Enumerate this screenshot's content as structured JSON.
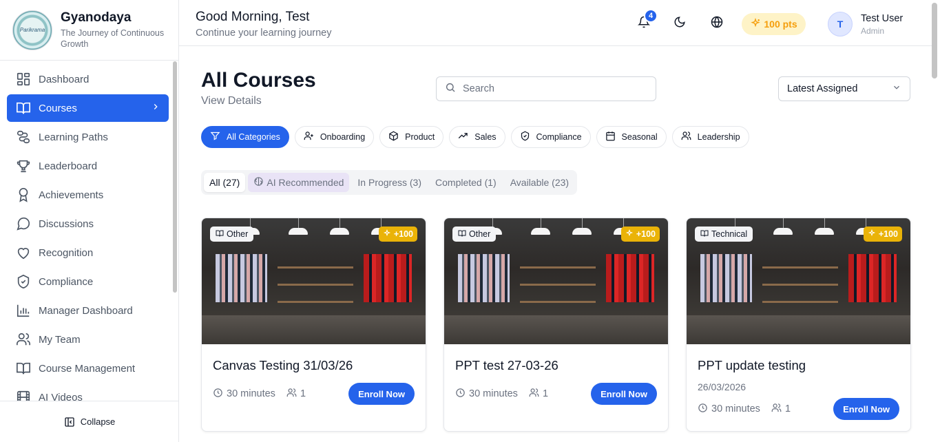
{
  "brand": {
    "title": "Gyanodaya",
    "subtitle": "The Journey of Continuous Growth",
    "logo_text": "Parikrama"
  },
  "sidebar": {
    "items": [
      {
        "label": "Dashboard",
        "icon": "dashboard-icon"
      },
      {
        "label": "Courses",
        "icon": "book-open-icon",
        "active": true
      },
      {
        "label": "Learning Paths",
        "icon": "route-icon"
      },
      {
        "label": "Leaderboard",
        "icon": "trophy-icon"
      },
      {
        "label": "Achievements",
        "icon": "award-icon"
      },
      {
        "label": "Discussions",
        "icon": "message-circle-icon"
      },
      {
        "label": "Recognition",
        "icon": "heart-icon"
      },
      {
        "label": "Compliance",
        "icon": "shield-check-icon"
      },
      {
        "label": "Manager Dashboard",
        "icon": "bar-chart-icon"
      },
      {
        "label": "My Team",
        "icon": "users-icon"
      },
      {
        "label": "Course Management",
        "icon": "book-icon"
      },
      {
        "label": "AI Videos",
        "icon": "film-icon"
      }
    ],
    "collapse_label": "Collapse"
  },
  "header": {
    "greeting": "Good Morning, Test",
    "greeting_sub": "Continue your learning journey",
    "notification_count": "4",
    "points": "100 pts",
    "user_initial": "T",
    "user_name": "Test User",
    "user_role": "Admin"
  },
  "main": {
    "title": "All Courses",
    "subtitle": "View Details",
    "search_placeholder": "Search",
    "sort_value": "Latest Assigned",
    "categories": [
      {
        "label": "All Categories",
        "icon": "filter-icon",
        "active": true
      },
      {
        "label": "Onboarding",
        "icon": "user-plus-icon"
      },
      {
        "label": "Product",
        "icon": "package-icon"
      },
      {
        "label": "Sales",
        "icon": "trending-up-icon"
      },
      {
        "label": "Compliance",
        "icon": "shield-icon"
      },
      {
        "label": "Seasonal",
        "icon": "calendar-icon"
      },
      {
        "label": "Leadership",
        "icon": "users-icon"
      }
    ],
    "tabs": [
      {
        "label": "All (27)",
        "active": true
      },
      {
        "label": "AI Recommended",
        "ai": true
      },
      {
        "label": "In Progress (3)"
      },
      {
        "label": "Completed (1)"
      },
      {
        "label": "Available (23)"
      }
    ],
    "courses": [
      {
        "category": "Other",
        "xp": "+100",
        "title": "Canvas Testing 31/03/26",
        "date": "",
        "duration": "30 minutes",
        "learners": "1",
        "action": "Enroll Now"
      },
      {
        "category": "Other",
        "xp": "+100",
        "title": "PPT test 27-03-26",
        "date": "",
        "duration": "30 minutes",
        "learners": "1",
        "action": "Enroll Now"
      },
      {
        "category": "Technical",
        "xp": "+100",
        "title": "PPT update testing",
        "date": "26/03/2026",
        "duration": "30 minutes",
        "learners": "1",
        "action": "Enroll Now"
      }
    ]
  },
  "colors": {
    "accent": "#2563eb",
    "points_bg": "#fef3c7",
    "points_fg": "#f59e0b",
    "xp_badge": "#eab308"
  }
}
